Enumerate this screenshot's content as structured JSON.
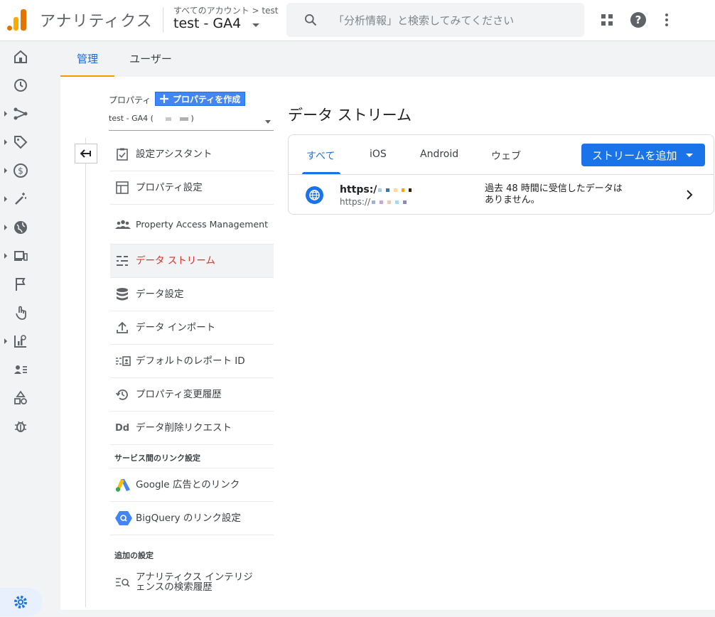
{
  "header": {
    "app_title": "アナリティクス",
    "breadcrumb": "すべてのアカウント > test",
    "property_name": "test - GA4",
    "search_placeholder": "「分析情報」と検索してみてください"
  },
  "colors": {
    "accent": "#1a73e8",
    "active_menu": "#d93025",
    "tab_indicator": "#f29900",
    "brand_orange": "#e37400",
    "brand_yellow": "#f9ab00"
  },
  "rail": {
    "items": [
      "home-icon",
      "clock-icon",
      "flow-icon",
      "tag-icon",
      "dollar-icon",
      "wand-icon",
      "globe-icon",
      "devices-icon",
      "flag-icon",
      "touch-icon",
      "report-icon",
      "audience-icon",
      "shapes-icon",
      "debug-icon"
    ],
    "active": "admin-gear-icon"
  },
  "tabs": [
    {
      "label": "管理",
      "active": true
    },
    {
      "label": "ユーザー",
      "active": false
    }
  ],
  "property_panel": {
    "label": "プロパティ",
    "create_button": "プロパティを作成",
    "selected_property": "test - GA4 (",
    "selected_property_suffix": ")",
    "menu": [
      {
        "label": "設定アシスタント",
        "icon": "checklist-icon"
      },
      {
        "label": "プロパティ設定",
        "icon": "layout-icon"
      },
      {
        "label": "Property Access Management",
        "icon": "people-icon"
      },
      {
        "label": "データ ストリーム",
        "icon": "stream-icon",
        "active": true
      },
      {
        "label": "データ設定",
        "icon": "database-icon"
      },
      {
        "label": "データ インポート",
        "icon": "upload-icon"
      },
      {
        "label": "デフォルトのレポート ID",
        "icon": "report-id-icon"
      },
      {
        "label": "プロパティ変更履歴",
        "icon": "history-icon"
      },
      {
        "label": "データ削除リクエスト",
        "icon": "dd-icon"
      }
    ],
    "links_section": "サービス間のリンク設定",
    "links": [
      {
        "label": "Google 広告とのリンク",
        "icon": "google-ads-icon"
      },
      {
        "label": "BigQuery のリンク設定",
        "icon": "bigquery-icon"
      }
    ],
    "additional_section": "追加の設定",
    "additional": [
      {
        "label": "アナリティクス インテリジェンスの検索履歴",
        "icon": "search-history-icon"
      }
    ]
  },
  "streams": {
    "title": "データ ストリーム",
    "filters": [
      "すべて",
      "iOS",
      "Android",
      "ウェブ"
    ],
    "active_filter": "すべて",
    "add_button": "ストリームを追加",
    "rows": [
      {
        "name": "https:/",
        "url": "https://",
        "status": "過去 48 時間に受信したデータはありません。"
      }
    ]
  }
}
